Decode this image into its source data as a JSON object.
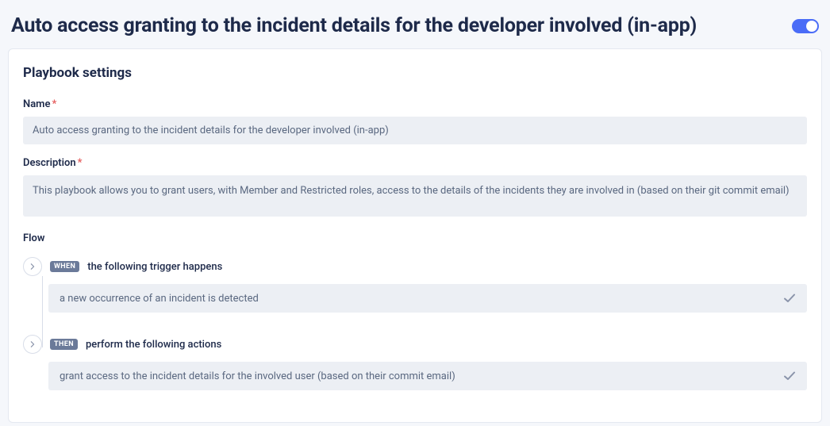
{
  "header": {
    "title": "Auto access granting to the incident details for the developer involved (in-app)",
    "toggle_on": true
  },
  "settings": {
    "section_title": "Playbook settings",
    "name_label": "Name",
    "name_value": "Auto access granting to the incident details for the developer involved (in-app)",
    "description_label": "Description",
    "description_value": "This playbook allows you to grant users, with Member and Restricted roles, access to the details of the incidents they are involved in (based on their git commit email)",
    "flow_label": "Flow"
  },
  "flow": {
    "when": {
      "badge": "WHEN",
      "header_text": "the following trigger happens",
      "item_text": "a new occurrence of an incident is detected"
    },
    "then": {
      "badge": "THEN",
      "header_text": "perform the following actions",
      "item_text": "grant access to the incident details for the involved user (based on their commit email)"
    }
  }
}
